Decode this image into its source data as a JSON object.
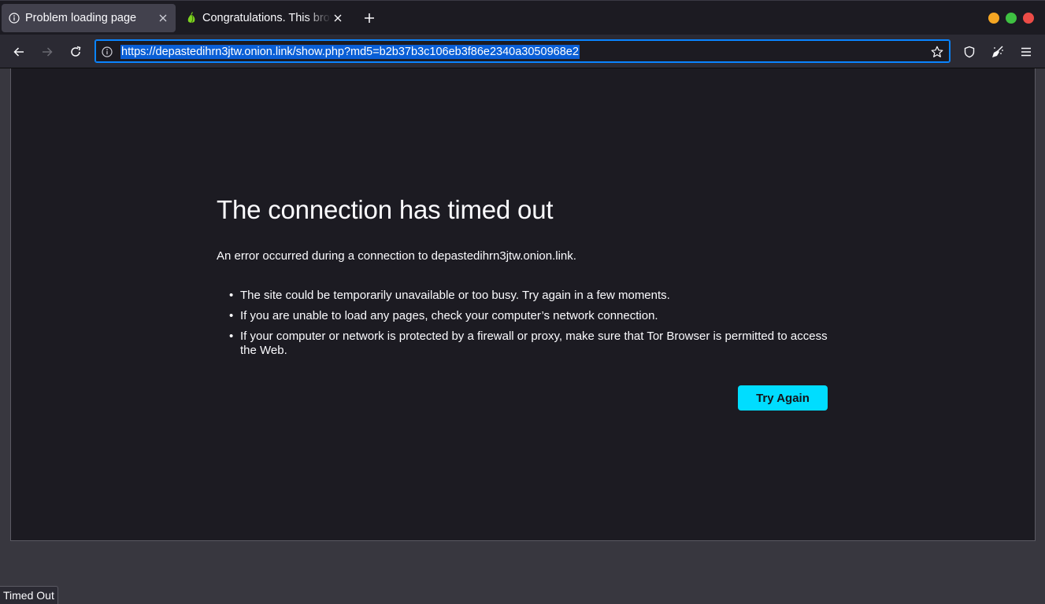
{
  "tabs": [
    {
      "title": "Problem loading page",
      "icon": "info-icon",
      "active": true
    },
    {
      "title": "Congratulations. This browser is configured to use Tor.",
      "icon": "onion-icon",
      "active": false
    }
  ],
  "window_controls": {
    "minimize_color": "#f5a623",
    "maximize_color": "#3fc142",
    "close_color": "#ec4c47"
  },
  "urlbar": {
    "url": "https://depastedihrn3jtw.onion.link/show.php?md5=b2b37b3c106eb3f86e2340a3050968e2"
  },
  "error": {
    "title": "The connection has timed out",
    "description": "An error occurred during a connection to depastedihrn3jtw.onion.link.",
    "suggestions": [
      "The site could be temporarily unavailable or too busy. Try again in a few moments.",
      "If you are unable to load any pages, check your computer’s network connection.",
      "If your computer or network is protected by a firewall or proxy, make sure that Tor Browser is permitted to access the Web."
    ],
    "button_label": "Try Again"
  },
  "status": {
    "text": "Timed Out"
  },
  "colors": {
    "accent": "#00ddff",
    "url_selection": "#0a5fd6",
    "focus_ring": "#0a84ff"
  }
}
